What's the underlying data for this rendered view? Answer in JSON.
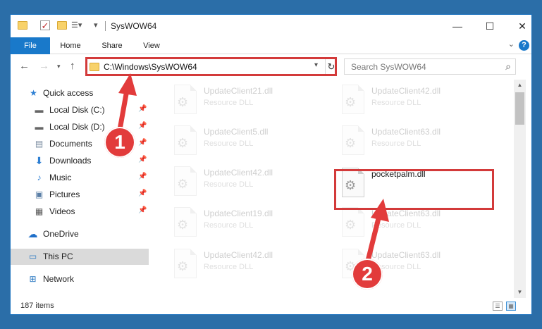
{
  "window": {
    "title": "SysWOW64",
    "controls": {
      "minimize": "—",
      "maximize": "☐",
      "close": "✕"
    }
  },
  "ribbon": {
    "tabs": [
      "File",
      "Home",
      "Share",
      "View"
    ],
    "help": "?"
  },
  "nav": {
    "address": "C:\\Windows\\SysWOW64",
    "search_placeholder": "Search SysWOW64"
  },
  "sidebar": {
    "items": [
      {
        "label": "Quick access",
        "icon": "star-icon"
      },
      {
        "label": "Local Disk (C:)",
        "icon": "drive-icon",
        "pinned": true
      },
      {
        "label": "Local Disk (D:)",
        "icon": "drive-icon",
        "pinned": true
      },
      {
        "label": "Documents",
        "icon": "documents-icon",
        "pinned": true
      },
      {
        "label": "Downloads",
        "icon": "download-icon",
        "pinned": true
      },
      {
        "label": "Music",
        "icon": "music-icon",
        "pinned": true
      },
      {
        "label": "Pictures",
        "icon": "pictures-icon",
        "pinned": true
      },
      {
        "label": "Videos",
        "icon": "videos-icon",
        "pinned": true
      },
      {
        "label": "OneDrive",
        "icon": "cloud-icon"
      },
      {
        "label": "This PC",
        "icon": "computer-icon",
        "selected": true
      },
      {
        "label": "Network",
        "icon": "network-icon"
      }
    ]
  },
  "files": [
    {
      "name": "UpdateClient21.dll",
      "type": "Resource DLL",
      "faded": true
    },
    {
      "name": "UpdateClient42.dll",
      "type": "Resource DLL",
      "faded": true
    },
    {
      "name": "UpdateClient5.dll",
      "type": "Resource DLL",
      "faded": true
    },
    {
      "name": "UpdateClient63.dll",
      "type": "Resource DLL",
      "faded": true
    },
    {
      "name": "UpdateClient42.dll",
      "type": "Resource DLL",
      "faded": true
    },
    {
      "name": "pocketpalm.dll",
      "type": "",
      "faded": false
    },
    {
      "name": "UpdateClient19.dll",
      "type": "Resource DLL",
      "faded": true
    },
    {
      "name": "UpdateClient63.dll",
      "type": "Resource DLL",
      "faded": true
    },
    {
      "name": "UpdateClient42.dll",
      "type": "Resource DLL",
      "faded": true
    },
    {
      "name": "UpdateClient63.dll",
      "type": "Resource DLL",
      "faded": true
    }
  ],
  "status": {
    "item_count": "187 items"
  },
  "annotations": {
    "step1": "1",
    "step2": "2",
    "color": "#e23b3b"
  }
}
